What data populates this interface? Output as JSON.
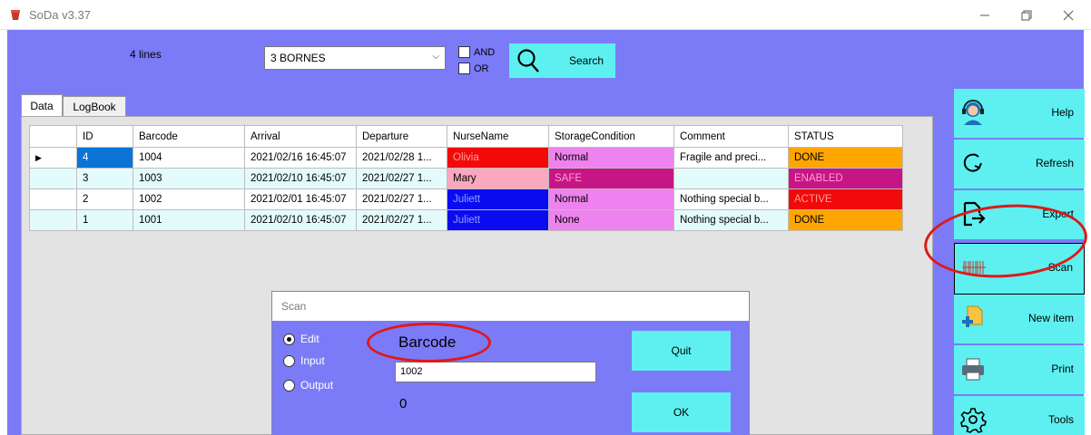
{
  "window": {
    "title": "SoDa v3.37",
    "minimize_icon": "minimize-icon",
    "maximize_icon": "restore-icon",
    "close_icon": "close-icon"
  },
  "toolbar": {
    "lines_count": "4 lines",
    "filter_selected": "3 BORNES",
    "and_label": "AND",
    "or_label": "OR",
    "search_label": "Search"
  },
  "tabs": [
    {
      "label": "Data"
    },
    {
      "label": "LogBook"
    }
  ],
  "grid": {
    "columns": [
      "ID",
      "Barcode",
      "Arrival",
      "Departure",
      "NurseName",
      "StorageCondition",
      "Comment",
      "STATUS"
    ],
    "rows": [
      {
        "id": "4",
        "barcode": "1004",
        "arrival": "2021/02/16 16:45:07",
        "departure": "2021/02/28 1...",
        "nurse": "Olivia",
        "storage": "Normal",
        "comment": "Fragile and preci...",
        "status": "DONE"
      },
      {
        "id": "3",
        "barcode": "1003",
        "arrival": "2021/02/10 16:45:07",
        "departure": "2021/02/27 1...",
        "nurse": "Mary",
        "storage": "SAFE",
        "comment": "",
        "status": "ENABLED"
      },
      {
        "id": "2",
        "barcode": "1002",
        "arrival": "2021/02/01 16:45:07",
        "departure": "2021/02/27 1...",
        "nurse": "Juliett",
        "storage": "Normal",
        "comment": "Nothing special b...",
        "status": "ACTIVE"
      },
      {
        "id": "1",
        "barcode": "1001",
        "arrival": "2021/02/10 16:45:07",
        "departure": "2021/02/27 1...",
        "nurse": "Juliett",
        "storage": "None",
        "comment": "Nothing special b...",
        "status": "DONE"
      }
    ]
  },
  "scan_dialog": {
    "title": "Scan",
    "modes": [
      {
        "label": "Edit",
        "selected": true
      },
      {
        "label": "Input",
        "selected": false
      },
      {
        "label": "Output",
        "selected": false
      }
    ],
    "barcode_label": "Barcode",
    "barcode_value": "1002",
    "count": "0",
    "quit_label": "Quit",
    "ok_label": "OK"
  },
  "side_buttons": [
    {
      "label": "Help",
      "icon": "headset-icon"
    },
    {
      "label": "Refresh",
      "icon": "refresh-icon"
    },
    {
      "label": "Export",
      "icon": "export-icon"
    },
    {
      "label": "Scan",
      "icon": "barcode-icon"
    },
    {
      "label": "New item",
      "icon": "new-item-icon"
    },
    {
      "label": "Print",
      "icon": "printer-icon"
    },
    {
      "label": "Tools",
      "icon": "gear-icon"
    }
  ],
  "colors": {
    "background": "#7b7bf8",
    "button": "#5ef0f0",
    "annotation": "#e01818"
  }
}
